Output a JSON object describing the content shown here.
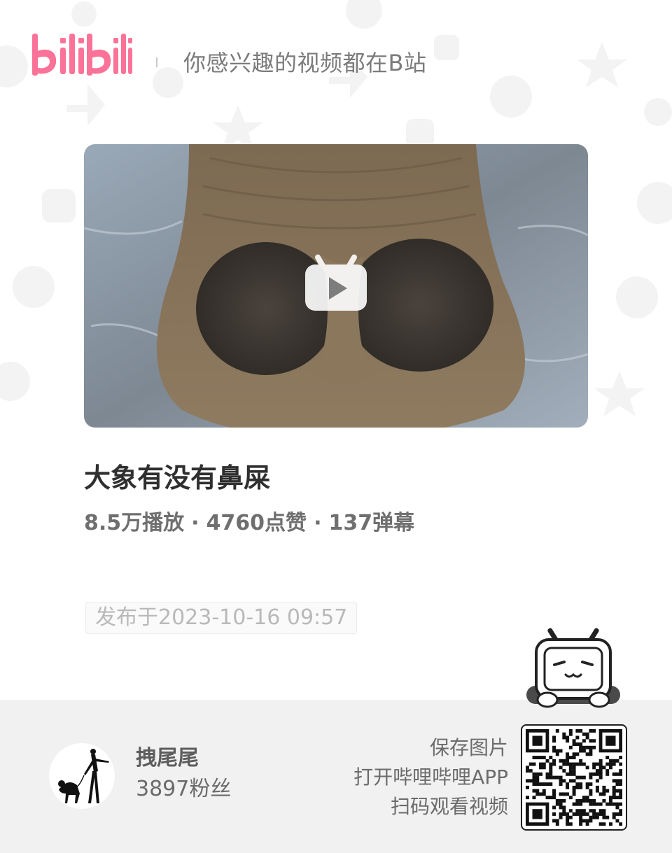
{
  "header": {
    "logo_text": "bilibili",
    "slogan": "你感兴趣的视频都在B站"
  },
  "video": {
    "title": "大象有没有鼻屎",
    "stats": {
      "plays": "8.5万播放",
      "likes": "4760点赞",
      "danmaku": "137弹幕",
      "separator": "·"
    },
    "publish_date": "发布于2023-10-16 09:57"
  },
  "uploader": {
    "name": "拽尾尾",
    "fans": "3897粉丝"
  },
  "cta": {
    "line1": "保存图片",
    "line2": "打开哔哩哔哩APP",
    "line3": "扫码观看视频"
  },
  "icons": {
    "logo": "bilibili-logo-icon",
    "play": "play-tv-icon",
    "mascot": "bilibili-tv-mascot-icon",
    "qr": "qr-code-icon",
    "avatar": "avatar-silhouette-icon"
  },
  "colors": {
    "brand_pink": "#fb7299",
    "footer_bg": "#f1f1f1",
    "title_text": "#2f2f2f",
    "muted_text": "#7b7b7b"
  }
}
